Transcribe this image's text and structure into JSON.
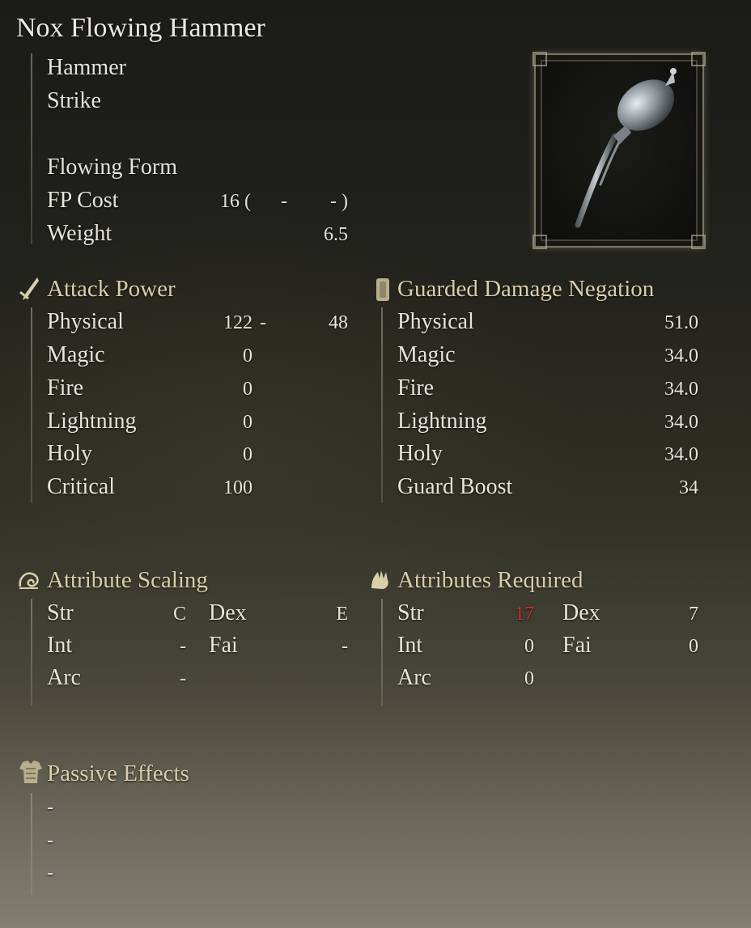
{
  "item": {
    "name": "Nox Flowing Hammer",
    "weapon_type": "Hammer",
    "damage_type": "Strike",
    "skill": "Flowing Form",
    "fp_cost": {
      "label": "FP Cost",
      "value": "16 (",
      "dash1": "-",
      "dash2": "-",
      "close": ")"
    },
    "weight": {
      "label": "Weight",
      "value": "6.5"
    }
  },
  "attack_power": {
    "header": "Attack Power",
    "physical_bonus_dash": "-",
    "rows": [
      {
        "label": "Physical",
        "value": "122",
        "bonus": "48"
      },
      {
        "label": "Magic",
        "value": "0"
      },
      {
        "label": "Fire",
        "value": "0"
      },
      {
        "label": "Lightning",
        "value": "0"
      },
      {
        "label": "Holy",
        "value": "0"
      },
      {
        "label": "Critical",
        "value": "100"
      }
    ]
  },
  "guarded_negation": {
    "header": "Guarded Damage Negation",
    "rows": [
      {
        "label": "Physical",
        "value": "51.0"
      },
      {
        "label": "Magic",
        "value": "34.0"
      },
      {
        "label": "Fire",
        "value": "34.0"
      },
      {
        "label": "Lightning",
        "value": "34.0"
      },
      {
        "label": "Holy",
        "value": "34.0"
      },
      {
        "label": "Guard Boost",
        "value": "34"
      }
    ]
  },
  "attribute_scaling": {
    "header": "Attribute Scaling",
    "str": {
      "label": "Str",
      "value": "C"
    },
    "dex": {
      "label": "Dex",
      "value": "E"
    },
    "int": {
      "label": "Int",
      "value": "-"
    },
    "fai": {
      "label": "Fai",
      "value": "-"
    },
    "arc": {
      "label": "Arc",
      "value": "-"
    }
  },
  "attributes_required": {
    "header": "Attributes Required",
    "str": {
      "label": "Str",
      "value": "17"
    },
    "dex": {
      "label": "Dex",
      "value": "7"
    },
    "int": {
      "label": "Int",
      "value": "0"
    },
    "fai": {
      "label": "Fai",
      "value": "0"
    },
    "arc": {
      "label": "Arc",
      "value": "0"
    }
  },
  "passive_effects": {
    "header": "Passive Effects",
    "items": [
      "-",
      "-",
      "-"
    ]
  },
  "colors": {
    "insufficient_stat": "#c9302c",
    "header_text": "#d9cfa9"
  },
  "icons": {
    "attack_power": "sword-icon",
    "guarded_negation": "shield-icon",
    "attribute_scaling": "scaling-arm-icon",
    "attributes_required": "required-hand-icon",
    "passive_effects": "armor-icon",
    "item_image": "hammer-image"
  }
}
